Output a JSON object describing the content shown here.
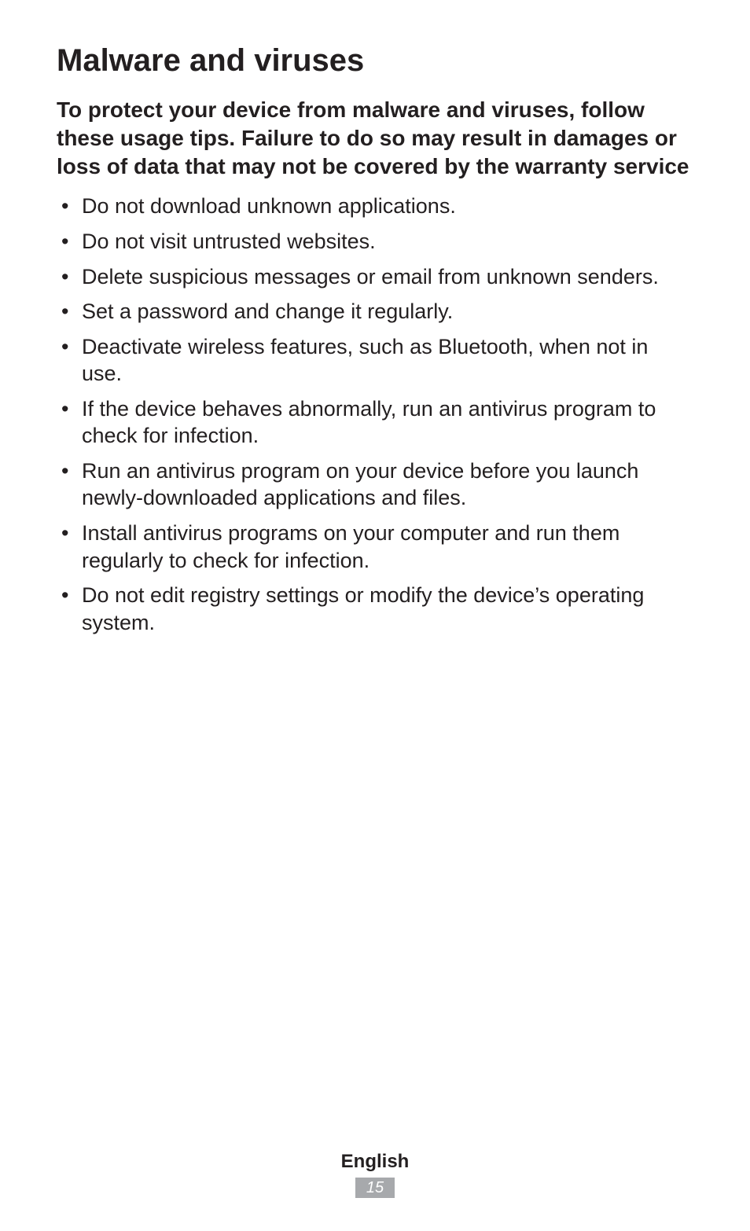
{
  "section_title": "Malware and viruses",
  "sub_heading": "To protect your device from malware and viruses, follow these usage tips. Failure to do so may result in damages or loss of data that may not be covered by the warranty service",
  "tips": [
    "Do not download unknown applications.",
    "Do not visit untrusted websites.",
    "Delete suspicious messages or email from unknown senders.",
    "Set a password and change it regularly.",
    "Deactivate wireless features, such as Bluetooth, when not in use.",
    "If the device behaves abnormally, run an antivirus program to check for infection.",
    "Run an antivirus program on your device before you launch newly-downloaded applications and files.",
    "Install antivirus programs on your computer and run them regularly to check for infection.",
    "Do not edit registry settings or modify the device’s operating system."
  ],
  "footer": {
    "language": "English",
    "page_number": "15"
  }
}
